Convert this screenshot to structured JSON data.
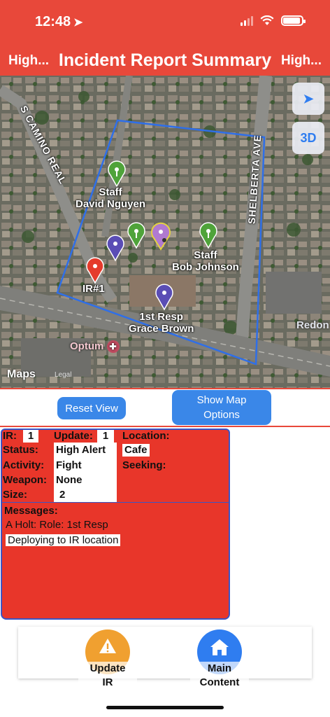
{
  "status_bar": {
    "time": "12:48"
  },
  "nav": {
    "left_label": "High...",
    "title": "Incident Report Summary",
    "right_label": "High..."
  },
  "map": {
    "streets": [
      "S CAMINO REAL",
      "SHELBERTA AVE"
    ],
    "controls": {
      "locate_icon": "location-arrow-icon",
      "mode_3d": "3D"
    },
    "pins": [
      {
        "label_line1": "Staff",
        "label_line2": "David Nguyen",
        "color": "#4fa33a"
      },
      {
        "label_line1": "Staff",
        "label_line2": "Bob Johnson",
        "color": "#4fa33a"
      },
      {
        "label_line1": "IR#1",
        "label_line2": "",
        "color": "#e53b2c"
      },
      {
        "label_line1": "1st Resp",
        "label_line2": "Grace Brown",
        "color": "#5a4db5"
      }
    ],
    "poi": "Optum",
    "poi_right": "Redon",
    "maps_logo": "Maps",
    "legal": "Legal"
  },
  "actions": {
    "reset_label": "Reset View",
    "options_line1": "Show Map",
    "options_line2": "Options"
  },
  "incident": {
    "ir_label": "IR:",
    "ir_value": "1",
    "update_label": "Update:",
    "update_value": "1",
    "location_label": "Location:",
    "location_value": "Cafe",
    "seeking_label": "Seeking:",
    "seeking_value": "",
    "status_label": "Status:",
    "status_value": "High Alert",
    "activity_label": "Activity:",
    "activity_value": "Fight",
    "weapon_label": "Weapon:",
    "weapon_value": "None",
    "size_label": "Size:",
    "size_value": "2"
  },
  "messages": {
    "header": "Messages:",
    "from_line": "A Holt: Role: 1st Resp",
    "body": "Deploying to IR location"
  },
  "tabs": [
    {
      "line1": "Update",
      "line2": "IR",
      "icon": "warning-icon",
      "color": "#f0a030"
    },
    {
      "line1": "Main",
      "line2": "Content",
      "icon": "home-icon",
      "color": "#2f7df0"
    }
  ]
}
